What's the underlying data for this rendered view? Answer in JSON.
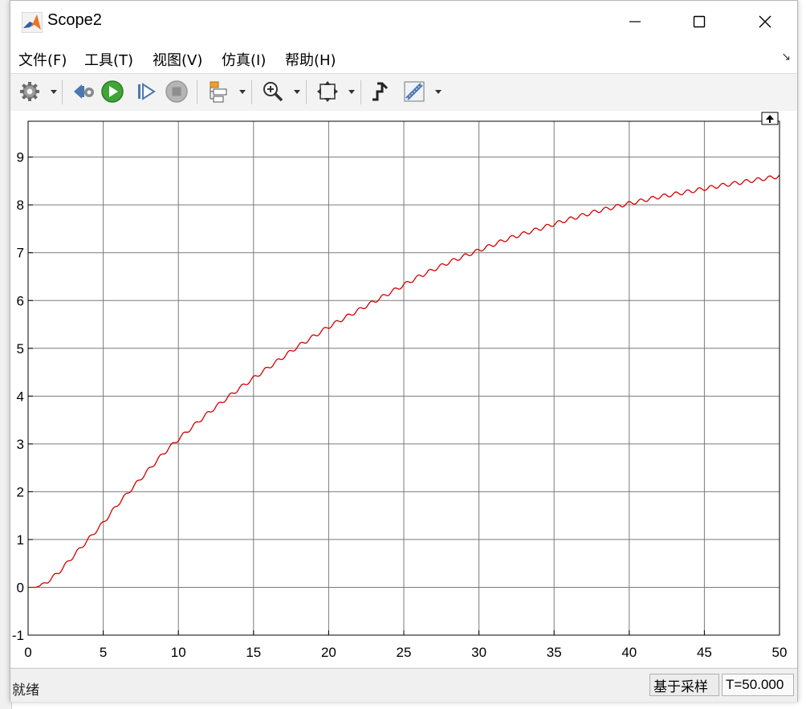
{
  "window": {
    "title": "Scope2",
    "controls": [
      "minimize",
      "maximize",
      "close"
    ]
  },
  "menu": {
    "items": [
      "文件(F)",
      "工具(T)",
      "视图(V)",
      "仿真(I)",
      "帮助(H)"
    ]
  },
  "toolbar": {
    "buttons": [
      "gear-icon",
      "step-back-icon",
      "run-icon",
      "step-forward-icon",
      "stop-icon",
      "signal-hierarchy-icon",
      "zoom-icon",
      "autoscale-icon",
      "highlight-icon",
      "measure-icon"
    ]
  },
  "status": {
    "text": "就绪",
    "mode": "基于采样",
    "time": "T=50.000"
  },
  "chart_data": {
    "type": "line",
    "title": "",
    "xlabel": "",
    "ylabel": "",
    "xlim": [
      0,
      50
    ],
    "ylim": [
      -1,
      9.75
    ],
    "xticks": [
      0,
      5,
      10,
      15,
      20,
      25,
      30,
      35,
      40,
      45,
      50
    ],
    "yticks": [
      -1,
      0,
      1,
      2,
      3,
      4,
      5,
      6,
      7,
      8,
      9
    ],
    "grid": true,
    "background": "#ffffff",
    "series": [
      {
        "color": "#d40000",
        "ripple": true,
        "x": [
          0,
          0.5,
          1,
          2,
          3,
          4,
          5,
          6,
          7,
          8,
          9,
          10,
          12,
          14,
          16,
          18,
          20,
          22,
          24,
          26,
          28,
          30,
          32,
          34,
          36,
          38,
          40,
          42,
          44,
          46,
          48,
          50
        ],
        "y": [
          0,
          0,
          0.05,
          0.3,
          0.65,
          1.0,
          1.35,
          1.75,
          2.1,
          2.45,
          2.8,
          3.1,
          3.65,
          4.15,
          4.6,
          5.05,
          5.45,
          5.8,
          6.15,
          6.5,
          6.8,
          7.05,
          7.3,
          7.5,
          7.7,
          7.88,
          8.03,
          8.17,
          8.28,
          8.4,
          8.5,
          8.6
        ]
      }
    ]
  }
}
